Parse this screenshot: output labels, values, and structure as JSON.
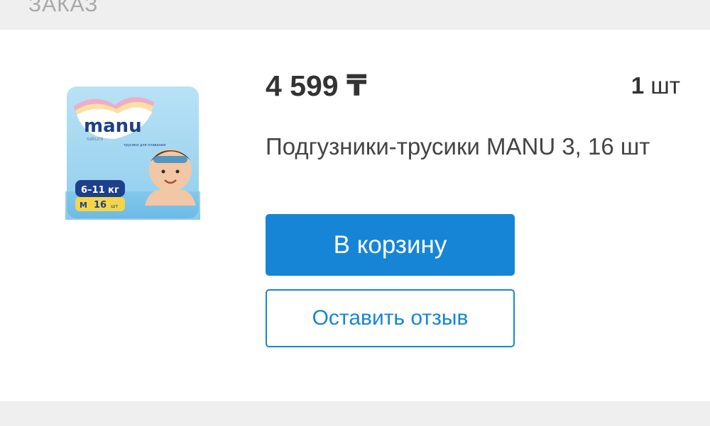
{
  "section": {
    "label": "ЗАКАЗ"
  },
  "product": {
    "price": "4 599 ₸",
    "quantity_number": "1",
    "quantity_unit": " шт",
    "name": "Подгузники-трусики MANU 3, 16 шт",
    "image": {
      "brand": "manu",
      "brand_sub": "sakura",
      "package_text": "трусики для плавания",
      "weight": "6–11 кг",
      "size": "M",
      "count": "16",
      "count_unit": "шт"
    }
  },
  "actions": {
    "cart_label": "В корзину",
    "review_label": "Оставить отзыв"
  },
  "colors": {
    "accent": "#1685d6",
    "text": "#333333",
    "background": "#efefef"
  }
}
